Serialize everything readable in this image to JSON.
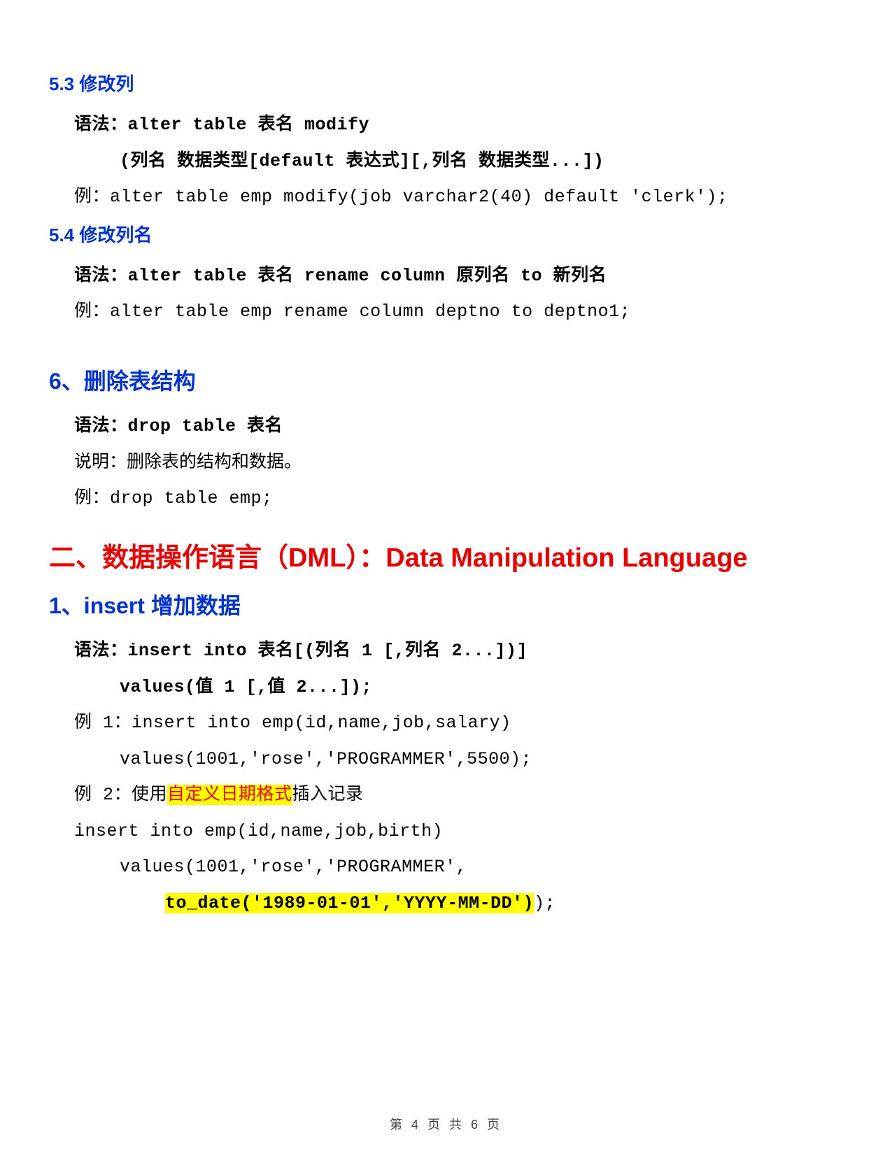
{
  "s53_title": "5.3 修改列",
  "s53_syntax1": "语法：alter table 表名 modify",
  "s53_syntax2": "(列名 数据类型[default 表达式][,列名 数据类型...])",
  "s53_example_label": "例：",
  "s53_example_code": "alter table emp modify(job varchar2(40) default 'clerk');",
  "s54_title": "5.4 修改列名",
  "s54_syntax": "语法：alter table 表名 rename column 原列名 to 新列名",
  "s54_example_label": "例：",
  "s54_example_code": "alter table emp rename column deptno to deptno1;",
  "s6_title": "6、删除表结构",
  "s6_syntax": "语法：drop table 表名",
  "s6_note": "说明：删除表的结构和数据。",
  "s6_example_label": "例：",
  "s6_example_code": "drop table emp;",
  "h1_title": "二、数据操作语言（DML）：Data Manipulation Language",
  "s1_title": "1、insert 增加数据",
  "s1_syntax1": "语法：insert into 表名[(列名 1 [,列名 2...])]",
  "s1_syntax2": "values(值 1 [,值 2...]);",
  "s1_ex1_label": "例 1：",
  "s1_ex1_line1": "insert into emp(id,name,job,salary)",
  "s1_ex1_line2": "values(1001,'rose','PROGRAMMER',5500);",
  "s1_ex2_label": "例 2：使用",
  "s1_ex2_hl": "自定义日期格式",
  "s1_ex2_suffix": "插入记录",
  "s1_ex2_line1": "insert into emp(id,name,job,birth)",
  "s1_ex2_line2": "values(1001,'rose','PROGRAMMER',",
  "s1_ex2_line3_hl": "to_date('1989-01-01','YYYY-MM-DD')",
  "s1_ex2_line3_suffix": ");",
  "footer": "第 4 页 共 6 页"
}
